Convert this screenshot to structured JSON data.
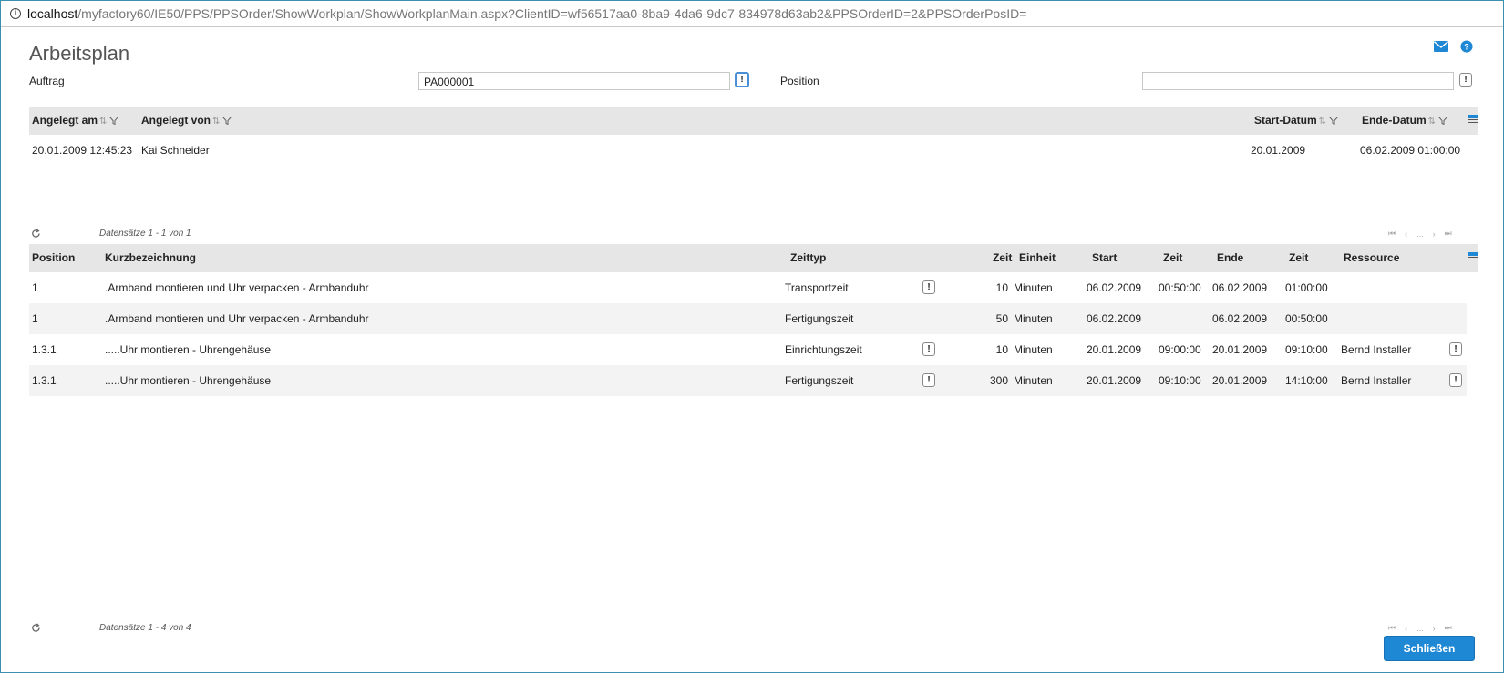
{
  "browser": {
    "url_host": "localhost",
    "url_path": "/myfactory60/IE50/PPS/PPSOrder/ShowWorkplan/ShowWorkplanMain.aspx?ClientID=wf56517aa0-8ba9-4da6-9dc7-834978d63ab2&PPSOrderID=2&PPSOrderPosID="
  },
  "page": {
    "title": "Arbeitsplan"
  },
  "icons": {
    "mail": "mail-icon",
    "help": "help-icon"
  },
  "form": {
    "auftrag_label": "Auftrag",
    "auftrag_value": "PA000001",
    "position_label": "Position",
    "position_value": ""
  },
  "orders_table": {
    "columns": {
      "angelegt_am": "Angelegt am",
      "angelegt_von": "Angelegt von",
      "start_datum": "Start-Datum",
      "ende_datum": "Ende-Datum"
    },
    "rows": [
      {
        "angelegt_am": "20.01.2009 12:45:23",
        "angelegt_von": "Kai Schneider",
        "start_datum": "20.01.2009",
        "ende_datum": "06.02.2009 01:00:00"
      }
    ],
    "pager_info": "Datensätze 1 - 1 von 1"
  },
  "workplan_table": {
    "columns": {
      "position": "Position",
      "kurzbezeichnung": "Kurzbezeichnung",
      "zeittyp": "Zeittyp",
      "zeit": "Zeit",
      "einheit": "Einheit",
      "start": "Start",
      "start_zeit": "Zeit",
      "ende": "Ende",
      "ende_zeit": "Zeit",
      "ressource": "Ressource"
    },
    "rows": [
      {
        "position": "1",
        "kurzbezeichnung": ".Armband montieren und Uhr verpacken - Armbanduhr",
        "zeittyp": "Transportzeit",
        "zeit": "10",
        "einheit": "Minuten",
        "start": "06.02.2009",
        "start_zeit": "00:50:00",
        "ende": "06.02.2009",
        "ende_zeit": "01:00:00",
        "ressource": ""
      },
      {
        "position": "1",
        "kurzbezeichnung": ".Armband montieren und Uhr verpacken - Armbanduhr",
        "zeittyp": "Fertigungszeit",
        "zeit": "50",
        "einheit": "Minuten",
        "start": "06.02.2009",
        "start_zeit": "",
        "ende": "06.02.2009",
        "ende_zeit": "00:50:00",
        "ressource": ""
      },
      {
        "position": "1.3.1",
        "kurzbezeichnung": ".....Uhr montieren - Uhrengehäuse",
        "zeittyp": "Einrichtungszeit",
        "zeit": "10",
        "einheit": "Minuten",
        "start": "20.01.2009",
        "start_zeit": "09:00:00",
        "ende": "20.01.2009",
        "ende_zeit": "09:10:00",
        "ressource": "Bernd Installer"
      },
      {
        "position": "1.3.1",
        "kurzbezeichnung": ".....Uhr montieren - Uhrengehäuse",
        "zeittyp": "Fertigungszeit",
        "zeit": "300",
        "einheit": "Minuten",
        "start": "20.01.2009",
        "start_zeit": "09:10:00",
        "ende": "20.01.2009",
        "ende_zeit": "14:10:00",
        "ressource": "Bernd Installer"
      }
    ],
    "pager_info": "Datensätze 1 - 4 von 4"
  },
  "pager_nav": {
    "first": "⏮",
    "prev": "‹",
    "ellipsis": "...",
    "next": "›",
    "last": "⏭"
  },
  "buttons": {
    "exclamation": "!",
    "close": "Schließen"
  },
  "colors": {
    "accent": "#1e88d4",
    "header_bg": "#e6e6e6",
    "alt_row": "#f3f3f3",
    "border": "#3d8fb0"
  }
}
